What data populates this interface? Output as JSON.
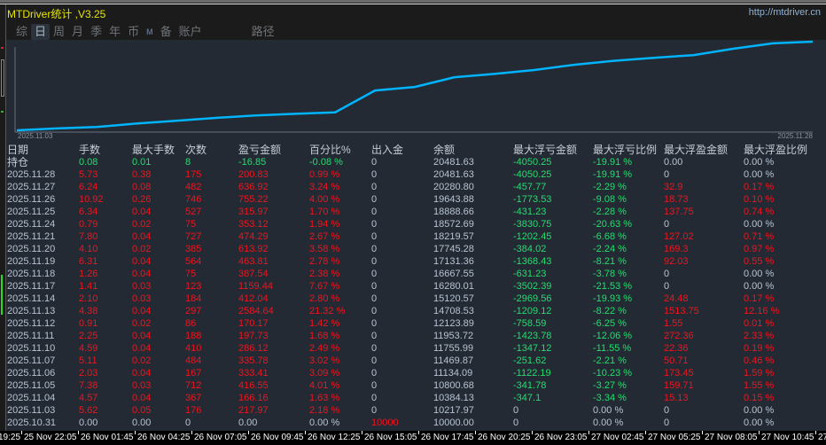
{
  "window": {
    "title": "MTDriver统计 ,V3.25",
    "url": "http://mtdriver.cn"
  },
  "tabs": [
    {
      "label": "综"
    },
    {
      "label": "日",
      "active": true
    },
    {
      "label": "周"
    },
    {
      "label": "月"
    },
    {
      "label": "季"
    },
    {
      "label": "年"
    },
    {
      "label": "币"
    },
    {
      "label": "M"
    },
    {
      "label": "备"
    },
    {
      "label": "账户"
    },
    {
      "label": "路径"
    }
  ],
  "chart": {
    "start_label": "2025.11.03",
    "end_label": "2025.11.28",
    "line_color": "#00b4ff"
  },
  "colors": {
    "profit": "#f0141e",
    "loss": "#1fe06c",
    "neutral": "#b7c3d3",
    "title": "#e6e600"
  },
  "table": {
    "headers": [
      "日期",
      "手数",
      "最大手数",
      "次数",
      "盈亏金额",
      "百分比%",
      "出入金",
      "余额",
      "最大浮亏金额",
      "最大浮亏比例",
      "最大浮盈金额",
      "最大浮盈比例"
    ],
    "rows": [
      [
        "持仓",
        "0.08",
        "0.01",
        "8",
        "-16.85",
        "-0.08 %",
        "0",
        "20481.63",
        "-4050.25",
        "-19.91 %",
        "0.00",
        "0.00 %"
      ],
      [
        "2025.11.28",
        "5.73",
        "0.38",
        "175",
        "200.83",
        "0.99 %",
        "0",
        "20481.63",
        "-4050.25",
        "-19.91 %",
        "0",
        "0.00 %"
      ],
      [
        "2025.11.27",
        "6.24",
        "0.08",
        "482",
        "636.92",
        "3.24 %",
        "0",
        "20280.80",
        "-457.77",
        "-2.29 %",
        "32.9",
        "0.17 %"
      ],
      [
        "2025.11.26",
        "10.92",
        "0.26",
        "746",
        "755.22",
        "4.00 %",
        "0",
        "19643.88",
        "-1773.53",
        "-9.08 %",
        "18.73",
        "0.10 %"
      ],
      [
        "2025.11.25",
        "6.34",
        "0.04",
        "527",
        "315.97",
        "1.70 %",
        "0",
        "18888.66",
        "-431.23",
        "-2.28 %",
        "137.75",
        "0.74 %"
      ],
      [
        "2025.11.24",
        "0.79",
        "0.02",
        "75",
        "353.12",
        "1.94 %",
        "0",
        "18572.69",
        "-3830.75",
        "-20.63 %",
        "0",
        "0.00 %"
      ],
      [
        "2025.11.21",
        "7.80",
        "0.04",
        "727",
        "474.29",
        "2.67 %",
        "0",
        "18219.57",
        "-1202.45",
        "-6.68 %",
        "127.02",
        "0.71 %"
      ],
      [
        "2025.11.20",
        "4.10",
        "0.02",
        "385",
        "613.92",
        "3.58 %",
        "0",
        "17745.28",
        "-384.02",
        "-2.24 %",
        "169.3",
        "0.97 %"
      ],
      [
        "2025.11.19",
        "6.31",
        "0.04",
        "564",
        "463.81",
        "2.78 %",
        "0",
        "17131.36",
        "-1368.43",
        "-8.21 %",
        "92.03",
        "0.55 %"
      ],
      [
        "2025.11.18",
        "1.26",
        "0.04",
        "75",
        "387.54",
        "2.38 %",
        "0",
        "16667.55",
        "-631.23",
        "-3.78 %",
        "0",
        "0.00 %"
      ],
      [
        "2025.11.17",
        "1.41",
        "0.03",
        "123",
        "1159.44",
        "7.67 %",
        "0",
        "16280.01",
        "-3502.39",
        "-21.53 %",
        "0",
        "0.00 %"
      ],
      [
        "2025.11.14",
        "2.10",
        "0.03",
        "184",
        "412.04",
        "2.80 %",
        "0",
        "15120.57",
        "-2969.56",
        "-19.93 %",
        "24.48",
        "0.17 %"
      ],
      [
        "2025.11.13",
        "4.38",
        "0.04",
        "297",
        "2584.64",
        "21.32 %",
        "0",
        "14708.53",
        "-1209.12",
        "-8.22 %",
        "1513.75",
        "12.16 %"
      ],
      [
        "2025.11.12",
        "0.91",
        "0.02",
        "86",
        "170.17",
        "1.42 %",
        "0",
        "12123.89",
        "-758.59",
        "-6.25 %",
        "1.55",
        "0.01 %"
      ],
      [
        "2025.11.11",
        "2.25",
        "0.04",
        "188",
        "197.73",
        "1.68 %",
        "0",
        "11953.72",
        "-1423.78",
        "-12.06 %",
        "272.36",
        "2.33 %"
      ],
      [
        "2025.11.10",
        "4.59",
        "0.04",
        "410",
        "286.12",
        "2.49 %",
        "0",
        "11755.99",
        "-1347.12",
        "-11.55 %",
        "22.36",
        "0.19 %"
      ],
      [
        "2025.11.07",
        "5.11",
        "0.02",
        "484",
        "335.78",
        "3.02 %",
        "0",
        "11469.87",
        "-251.62",
        "-2.21 %",
        "50.71",
        "0.46 %"
      ],
      [
        "2025.11.06",
        "2.03",
        "0.04",
        "167",
        "333.41",
        "3.09 %",
        "0",
        "11134.09",
        "-1122.19",
        "-10.23 %",
        "173.45",
        "1.59 %"
      ],
      [
        "2025.11.05",
        "7.38",
        "0.03",
        "712",
        "416.55",
        "4.01 %",
        "0",
        "10800.68",
        "-341.78",
        "-3.27 %",
        "159.71",
        "1.55 %"
      ],
      [
        "2025.11.04",
        "4.57",
        "0.04",
        "367",
        "166.16",
        "1.63 %",
        "0",
        "10384.13",
        "-347.1",
        "-3.34 %",
        "15.13",
        "0.15 %"
      ],
      [
        "2025.11.03",
        "5.62",
        "0.05",
        "176",
        "217.97",
        "2.18 %",
        "0",
        "10217.97",
        "0",
        "0.00 %",
        "0",
        "0.00 %"
      ],
      [
        "2025.10.31",
        "0.00",
        "0.00",
        "0",
        "0.00",
        "0.00 %",
        "10000",
        "10000.00",
        "0",
        "0.00 %",
        "0",
        "0.00 %"
      ]
    ]
  },
  "time_axis": [
    "19:25",
    "25 Nov 22:05",
    "26 Nov 01:45",
    "26 Nov 04:25",
    "26 Nov 07:05",
    "26 Nov 09:45",
    "26 Nov 12:25",
    "26 Nov 15:05",
    "26 Nov 17:45",
    "26 Nov 20:25",
    "26 Nov 23:05",
    "27 Nov 02:45",
    "27 Nov 05:25",
    "27 Nov 08:05",
    "27 Nov 10:45",
    "27"
  ]
}
